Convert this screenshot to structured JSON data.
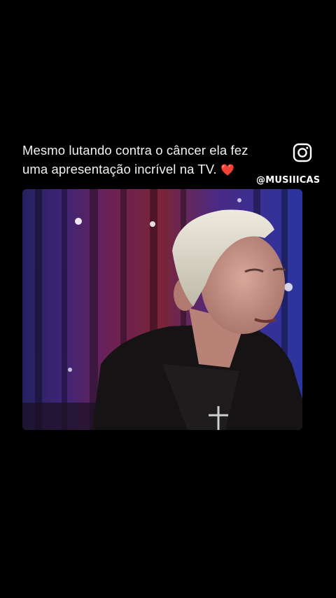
{
  "post": {
    "caption": "Mesmo lutando contra o câncer ela fez uma apresentação incrível na TV.",
    "caption_emoji": "❤️",
    "handle": "@MUSIIICAS"
  },
  "icons": {
    "instagram": "instagram-icon",
    "heart": "heart-emoji"
  },
  "colors": {
    "background": "#000000",
    "text": "#f2f2f2",
    "heart": "#e0243a"
  }
}
